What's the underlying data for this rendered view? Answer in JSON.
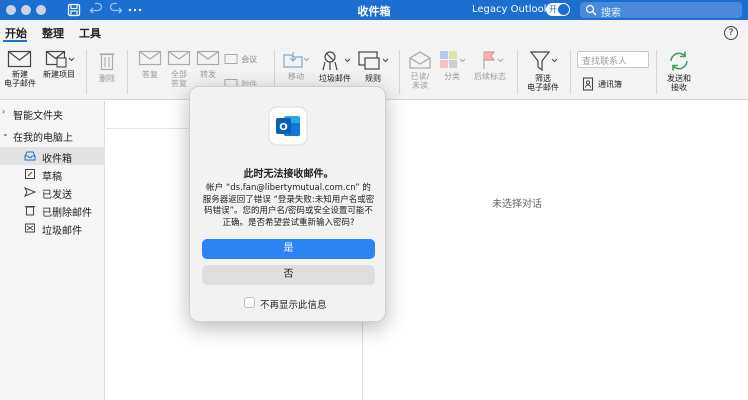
{
  "titlebar": {
    "title": "收件箱",
    "legacy_label": "Legacy Outlook",
    "toggle_label": "开",
    "search_placeholder": "搜索"
  },
  "menu": {
    "tabs": [
      "开始",
      "整理",
      "工具"
    ],
    "help": "?"
  },
  "ribbon": {
    "new_email": "新建\n电子邮件",
    "new_item": "新建项目",
    "delete": "删除",
    "reply": "答复",
    "reply_all": "全部\n答复",
    "forward": "转发",
    "meeting": "会议",
    "attachment": "附件",
    "move": "移动",
    "junk": "垃圾邮件",
    "rules": "规则",
    "read_unread": "已读/\n未读",
    "categorize": "分类",
    "follow_up": "后续标志",
    "filter_email": "筛选\n电子邮件",
    "search_contacts_placeholder": "查找联系人",
    "address_book": "通讯簿",
    "send_receive": "发送和\n接收"
  },
  "sidebar": {
    "smart_folders": "智能文件夹",
    "on_my_computer": "在我的电脑上",
    "items": [
      "收件箱",
      "草稿",
      "已发送",
      "已删除邮件",
      "垃圾邮件"
    ]
  },
  "reading_pane": {
    "empty_text": "未选择对话"
  },
  "dialog": {
    "title": "此时无法接收邮件。",
    "message": "帐户 “ds.fan@libertymutual.com.cn” 的服务器返回了错误 “登录失败:未知用户名或密码错误”。您的用户名/密码或安全设置可能不正确。是否希望尝试重新输入密码?",
    "yes": "是",
    "no": "否",
    "dont_show": "不再显示此信息"
  },
  "colors": {
    "accent": "#1c6fd1",
    "primary_button": "#2b84f4"
  }
}
